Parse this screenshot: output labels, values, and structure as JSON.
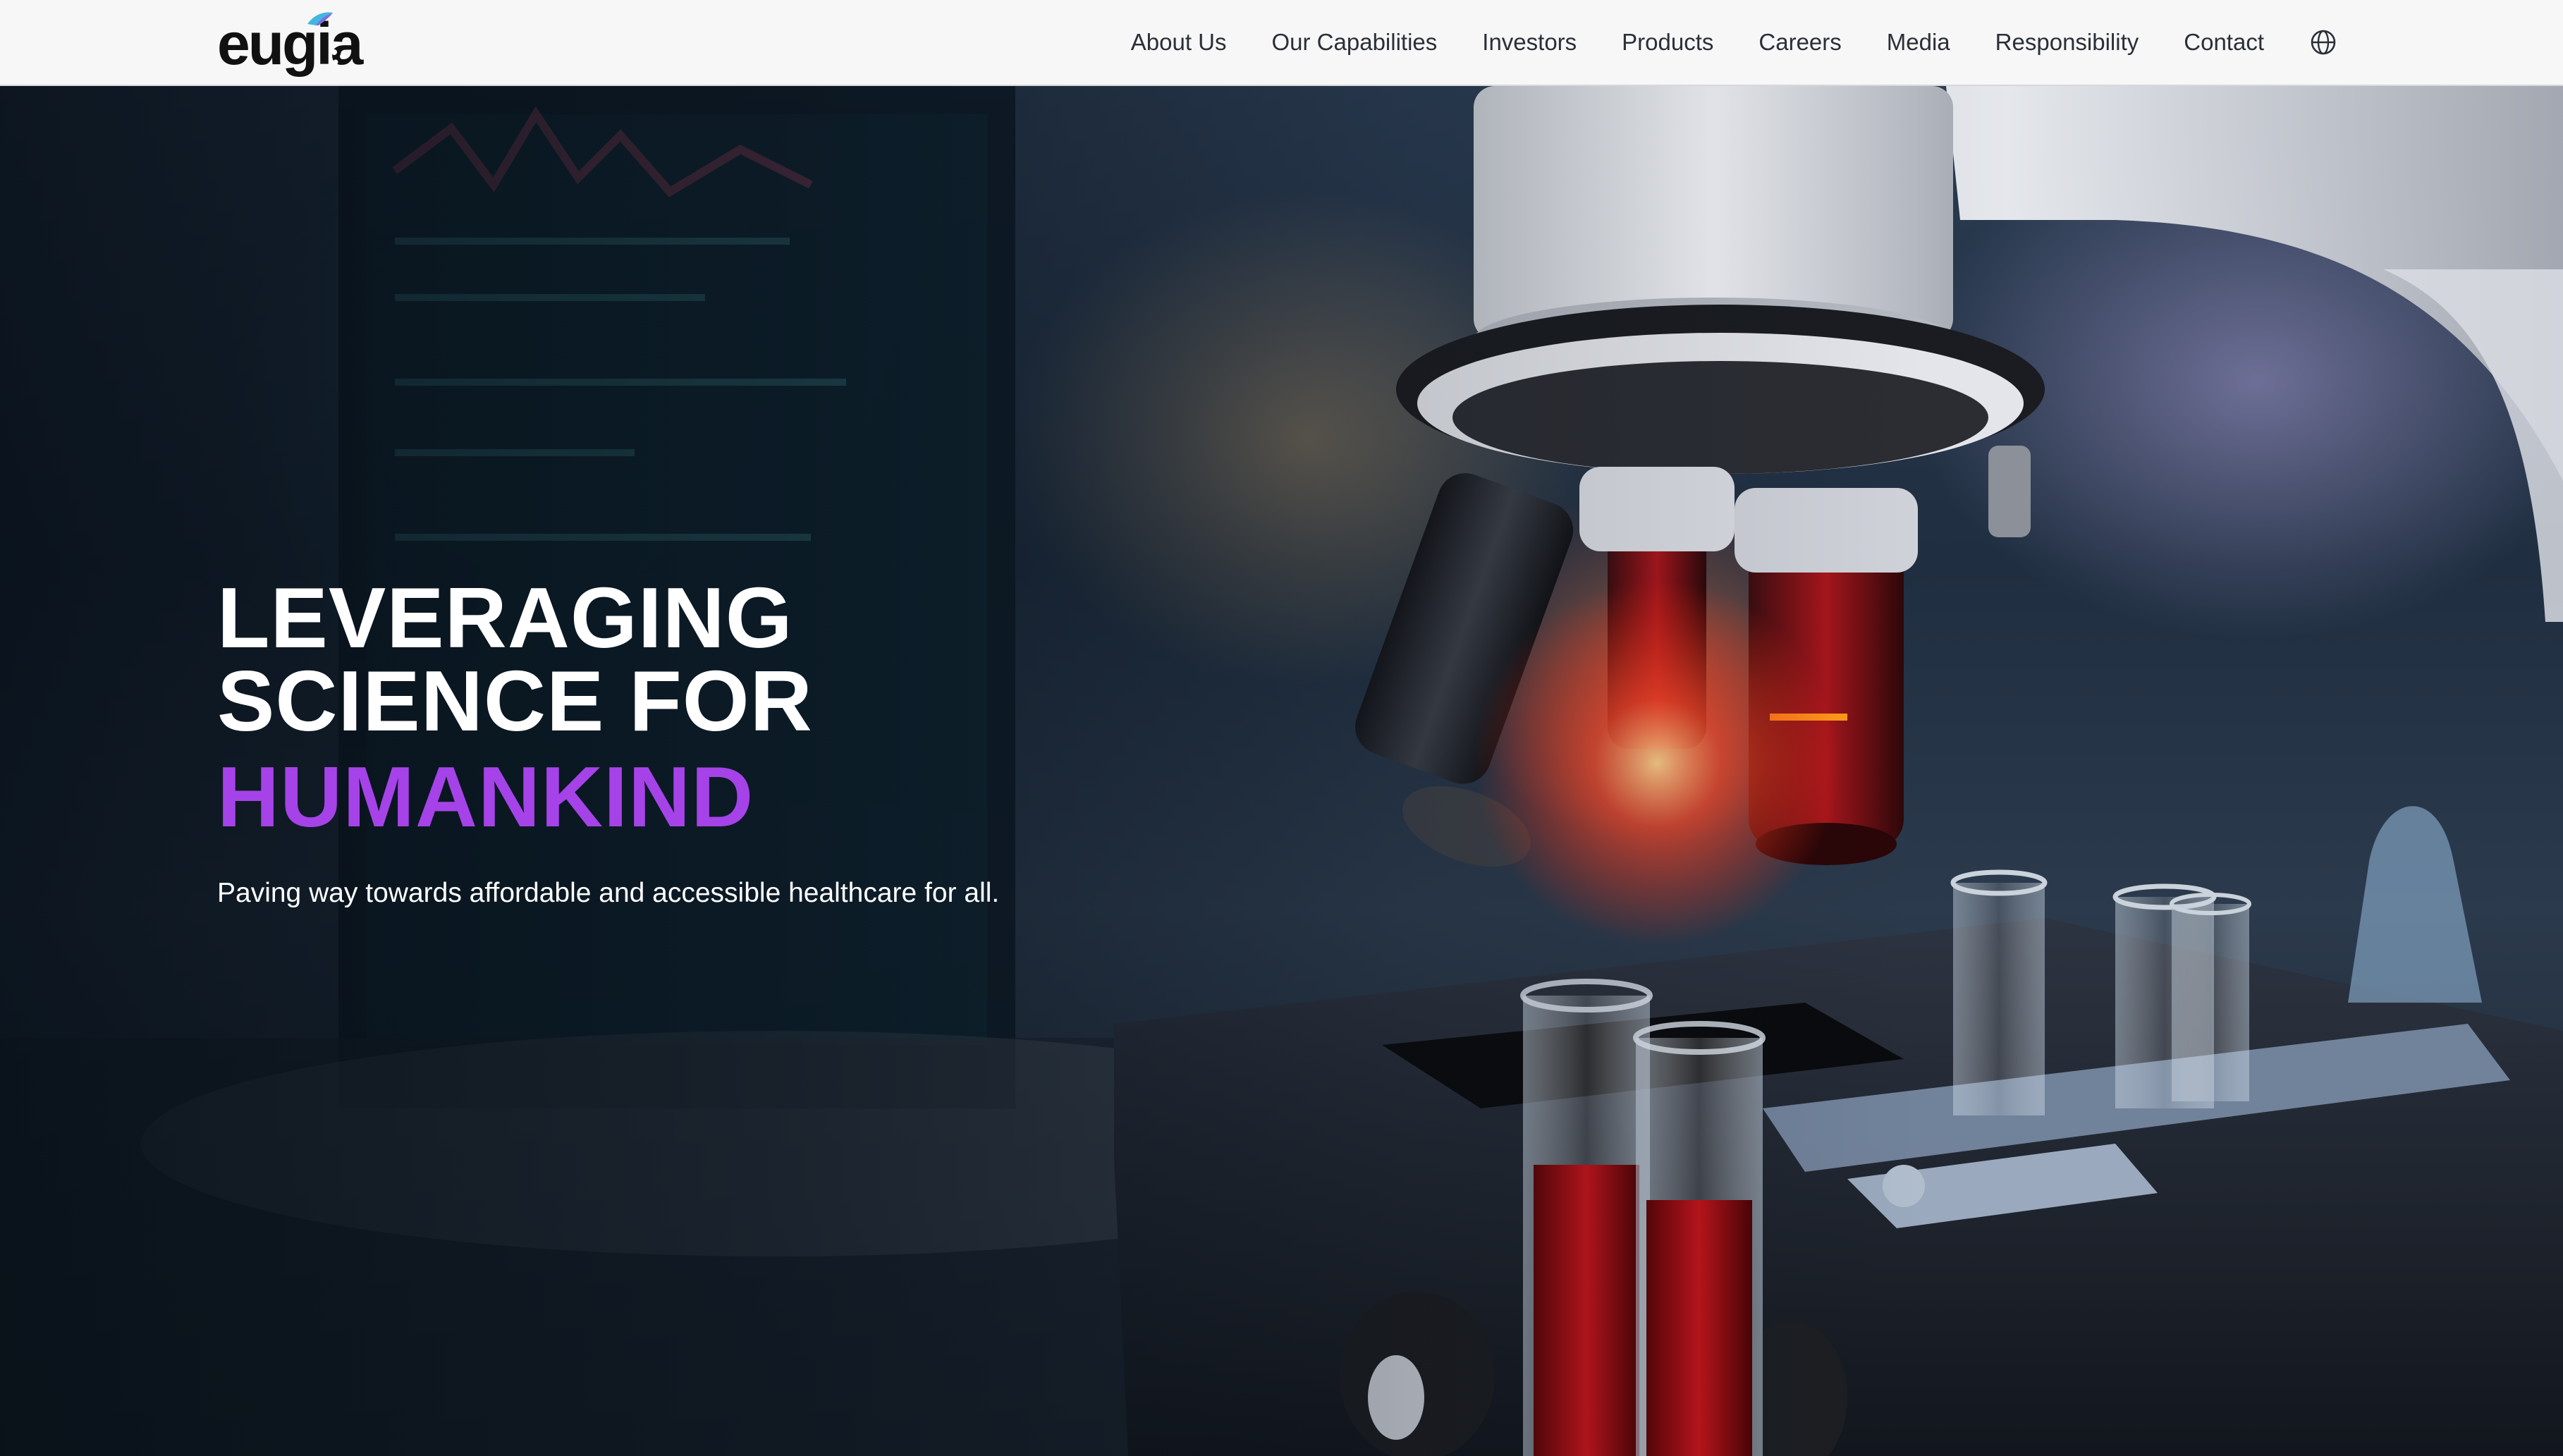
{
  "header": {
    "logo_text": "eugia",
    "nav": [
      {
        "label": "About Us"
      },
      {
        "label": "Our Capabilities"
      },
      {
        "label": "Investors"
      },
      {
        "label": "Products"
      },
      {
        "label": "Careers"
      },
      {
        "label": "Media"
      },
      {
        "label": "Responsibility"
      },
      {
        "label": "Contact"
      }
    ],
    "language_icon": "globe-icon"
  },
  "hero": {
    "title_line1": "LEVERAGING",
    "title_line2": "SCIENCE FOR",
    "title_accent": "HUMANKIND",
    "subtitle": "Paving way towards affordable and accessible healthcare for all.",
    "background_image": "laboratory-microscope-with-test-tubes",
    "colors": {
      "accent": "#a543e8",
      "title": "#ffffff",
      "header_bg": "#f7f7f7",
      "nav_text": "#2a2f38"
    }
  }
}
